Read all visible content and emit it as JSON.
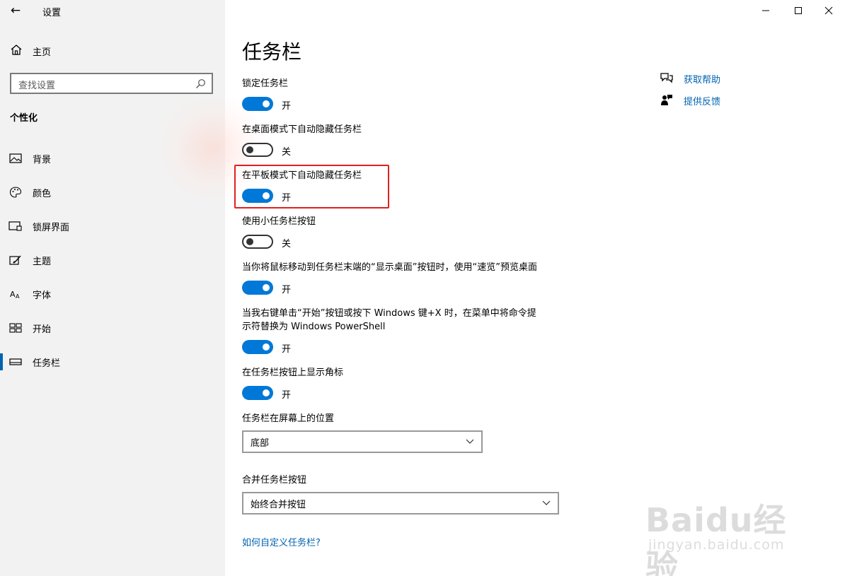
{
  "window": {
    "title": "设置",
    "minimize_label": "—",
    "maximize_label": "☐",
    "close_label": "✕"
  },
  "sidebar": {
    "back_glyph": "←",
    "home_label": "主页",
    "search_placeholder": "查找设置",
    "section_title": "个性化",
    "items": [
      {
        "label": "背景",
        "icon": "image-icon"
      },
      {
        "label": "颜色",
        "icon": "palette-icon"
      },
      {
        "label": "锁屏界面",
        "icon": "lock-screen-icon"
      },
      {
        "label": "主题",
        "icon": "theme-icon"
      },
      {
        "label": "字体",
        "icon": "font-icon"
      },
      {
        "label": "开始",
        "icon": "start-icon"
      },
      {
        "label": "任务栏",
        "icon": "taskbar-icon",
        "active": true
      }
    ]
  },
  "main": {
    "title": "任务栏",
    "settings": [
      {
        "label": "锁定任务栏",
        "state": "开",
        "on": true
      },
      {
        "label": "在桌面模式下自动隐藏任务栏",
        "state": "关",
        "on": false
      },
      {
        "label": "在平板模式下自动隐藏任务栏",
        "state": "开",
        "on": true
      },
      {
        "label": "使用小任务栏按钮",
        "state": "关",
        "on": false
      },
      {
        "label": "当你将鼠标移动到任务栏末端的“显示桌面”按钮时，使用“速览”预览桌面",
        "state": "开",
        "on": true
      },
      {
        "label_line1": "当我右键单击“开始”按钮或按下 Windows 键+X 时，在菜单中将命令提",
        "label_line2": "示符替换为 Windows PowerShell",
        "state": "开",
        "on": true
      },
      {
        "label": "在任务栏按钮上显示角标",
        "state": "开",
        "on": true
      }
    ],
    "position": {
      "label": "任务栏在屏幕上的位置",
      "value": "底部"
    },
    "combine": {
      "label": "合并任务栏按钮",
      "value": "始终合并按钮"
    },
    "customize_link": "如何自定义任务栏?"
  },
  "help": {
    "get_help": "获取帮助",
    "feedback": "提供反馈"
  },
  "watermark": {
    "brand": "Baidu经验",
    "url": "jingyan.baidu.com"
  },
  "colors": {
    "accent": "#0078d7",
    "link": "#0063b1",
    "highlight": "#e02020",
    "sidebar_bg": "#f2f2f2"
  }
}
